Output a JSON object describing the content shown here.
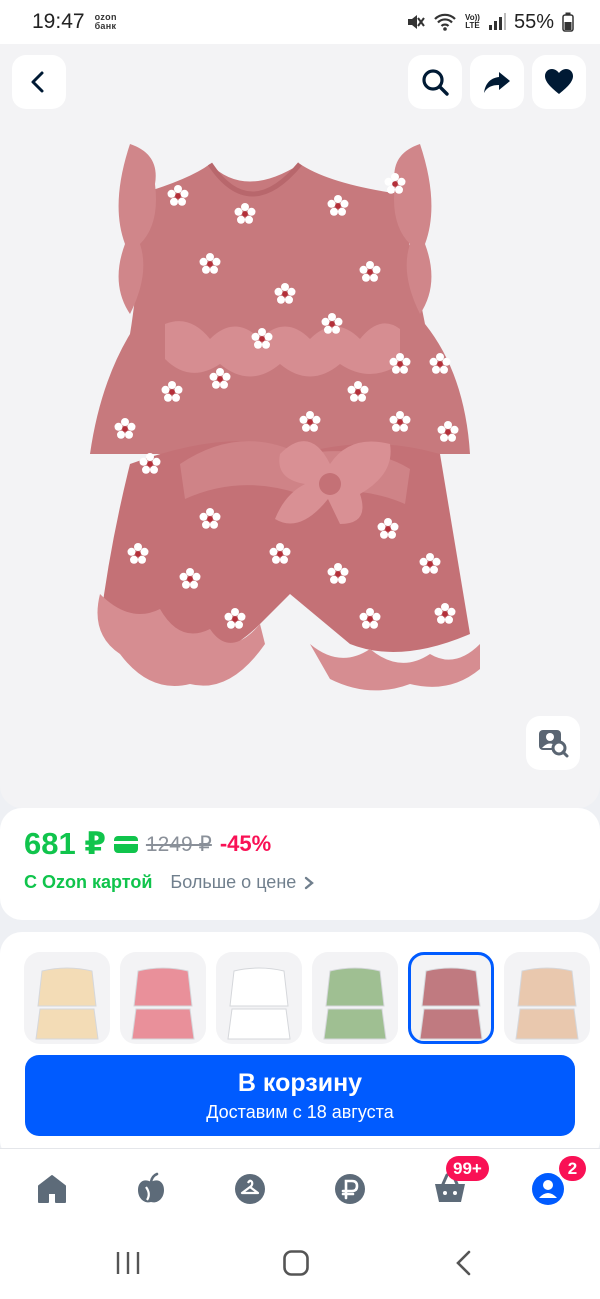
{
  "status_bar": {
    "time": "19:47",
    "ozon_bank_line1": "ozon",
    "ozon_bank_line2": "банк",
    "volte_line1": "Vo))",
    "volte_line2": "LTE",
    "battery": "55%"
  },
  "product": {
    "icons": [
      "back-arrow-icon",
      "search-icon",
      "share-icon",
      "heart-icon",
      "visual-search-icon"
    ]
  },
  "price": {
    "current": "681 ₽",
    "old": "1249 ₽",
    "discount": "-45%",
    "ozon_card_label": "С Ozon картой",
    "more_about_price": "Больше о цене"
  },
  "variants": [
    {
      "color": "#f3dcb6"
    },
    {
      "color": "#e9909a"
    },
    {
      "color": "#ffffff"
    },
    {
      "color": "#9fbf92"
    },
    {
      "color": "#c07a80"
    },
    {
      "color": "#e9c8ae"
    }
  ],
  "cart_button": {
    "label": "В корзину",
    "sublabel": "Доставим с 18 августа"
  },
  "tab_bar": {
    "cart_badge": "99+",
    "profile_badge": "2"
  },
  "colors": {
    "accent": "#005bff",
    "price_green": "#10c44c",
    "discount_pink": "#f91155"
  }
}
